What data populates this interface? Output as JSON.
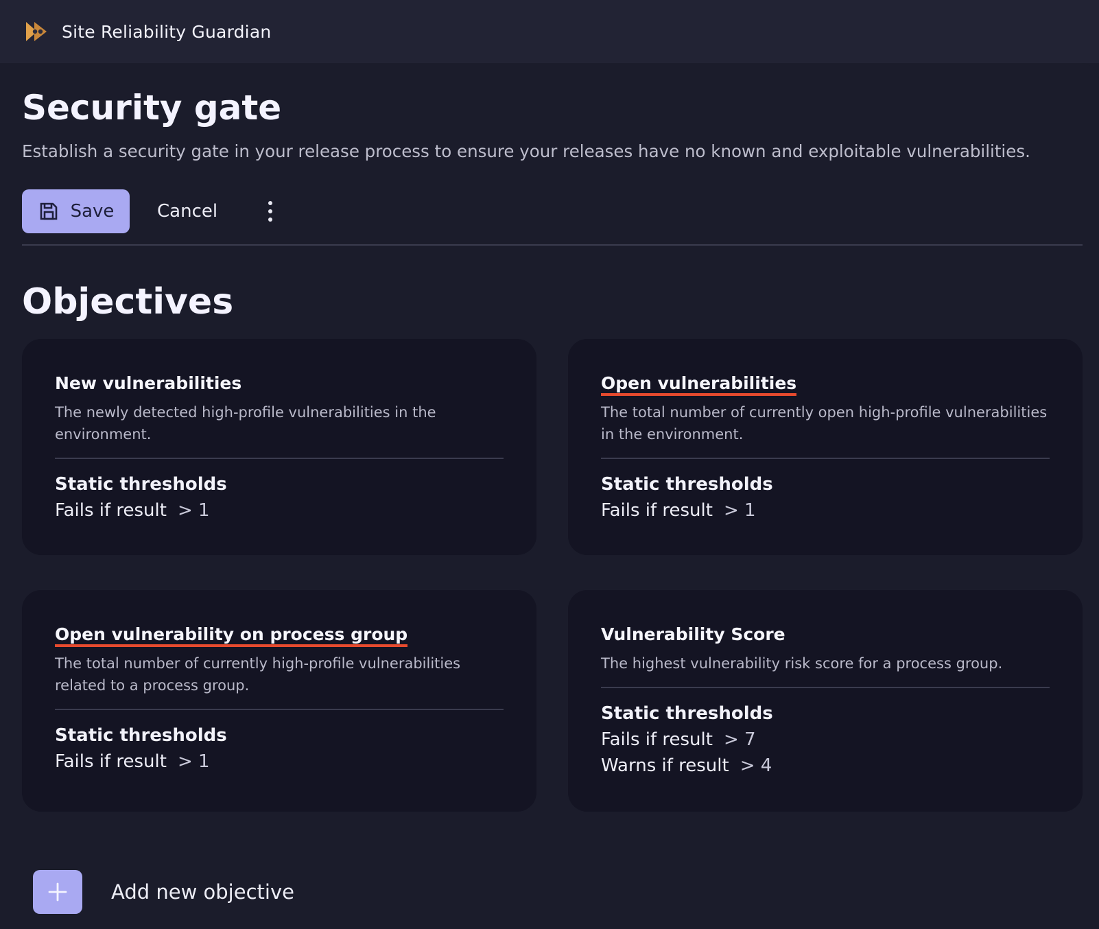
{
  "app": {
    "title": "Site Reliability Guardian"
  },
  "page": {
    "title": "Security gate",
    "description": "Establish a security gate in your release process to ensure your releases have no known and exploitable vulnerabilities."
  },
  "toolbar": {
    "save_label": "Save",
    "cancel_label": "Cancel",
    "more_icon": "more-vertical-icon"
  },
  "objectives": {
    "title": "Objectives",
    "cards": [
      {
        "title": "New vulnerabilities",
        "description": "The newly detected high-profile vulnerabilities in the environment.",
        "thresholds_title": "Static thresholds",
        "fail_label": "Fails if result",
        "fail_value": "> 1"
      },
      {
        "title": "Open vulnerabilities",
        "description": "The total number of currently open high-profile vulnerabilities in the environment.",
        "thresholds_title": "Static thresholds",
        "fail_label": "Fails if result",
        "fail_value": "> 1"
      },
      {
        "title": "Open vulnerability on process group",
        "description": "The total number of currently high-profile vulnerabilities related to a process group.",
        "thresholds_title": "Static thresholds",
        "fail_label": "Fails if result",
        "fail_value": "> 1"
      },
      {
        "title": "Vulnerability Score",
        "description": "The highest vulnerability risk score for a process group.",
        "thresholds_title": "Static thresholds",
        "fail_label": "Fails if result",
        "fail_value": "> 7",
        "warn_label": "Warns if result",
        "warn_value": "> 4"
      }
    ],
    "add_label": "Add new objective"
  },
  "colors": {
    "background": "#1b1c2b",
    "card": "#141423",
    "accent": "#a9a9f2",
    "underline": "#e64a2e"
  }
}
